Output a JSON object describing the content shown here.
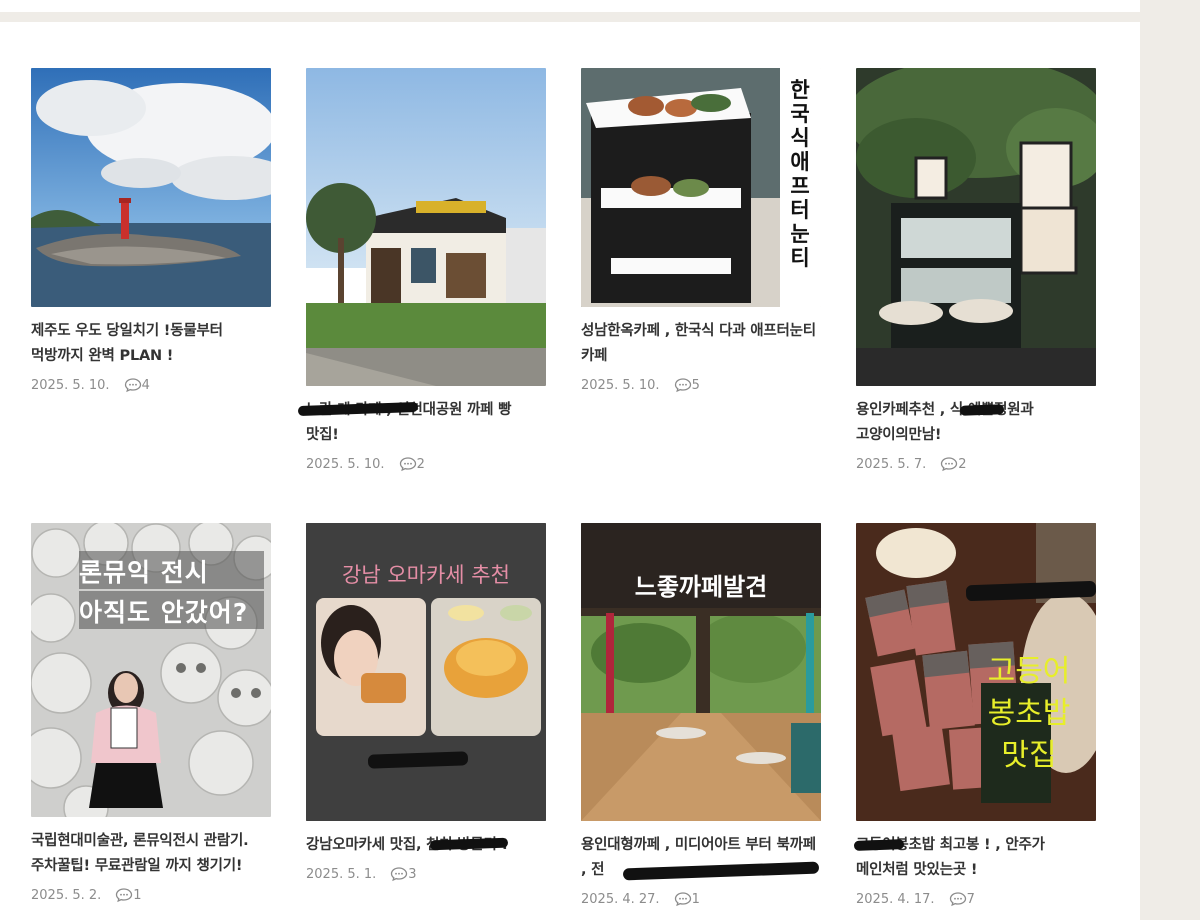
{
  "colors": {
    "accent_text": "#333333",
    "meta_text": "#8c8c8c",
    "page_bg": "#efece7"
  },
  "posts": [
    {
      "title": "제주도 우도 당일치기 !동물부터 먹방까지 완벽 PLAN !",
      "date": "2025. 5. 10.",
      "comments": "4",
      "image": "jeju-udo-lighthouse-sea"
    },
    {
      "title": "노란 계 카페 , 인천대공원 까페 빵 맛집!",
      "date": "2025. 5. 10.",
      "comments": "2",
      "image": "hanok-cafe-exterior"
    },
    {
      "title": "성남한옥카페 , 한국식 다과 애프터눈티 카페",
      "date": "2025. 5. 10.",
      "comments": "5",
      "image": "afternoon-tea-stand",
      "overlay": "한국식 애프터눈티"
    },
    {
      "title": "용인카페추천 , 식 예쁜정원과 고양이의만남!",
      "date": "2025. 5. 7.",
      "comments": "2",
      "image": "garden-cafe-dessert-case"
    },
    {
      "title": "국립현대미술관, 론뮤익전시 관람기. 주차꿀팁! 무료관람일 까지 챙기기!",
      "date": "2025. 5. 2.",
      "comments": "1",
      "image": "skull-exhibition",
      "overlay_line1": "론뮤익 전시",
      "overlay_line2": "아직도 안갔어?"
    },
    {
      "title": "강남오마카세 맛집, 천치 방문기 !",
      "date": "2025. 5. 1.",
      "comments": "3",
      "image": "omakase-sushi",
      "overlay": "강남 오마카세 추천"
    },
    {
      "title": "용인대형까페 , 미디어아트 부터 북까페 , 전",
      "date": "2025. 4. 27.",
      "comments": "1",
      "image": "large-cafe-interior",
      "overlay": "느좋까페발견"
    },
    {
      "title": "고등어봉초밥 최고봉 ! , 안주가 메인처럼 맛있는곳 !",
      "date": "2025. 4. 17.",
      "comments": "7",
      "image": "mackerel-sushi",
      "overlay_line1": "고등어",
      "overlay_line2": "봉초밥",
      "overlay_line3": "맛집"
    }
  ]
}
